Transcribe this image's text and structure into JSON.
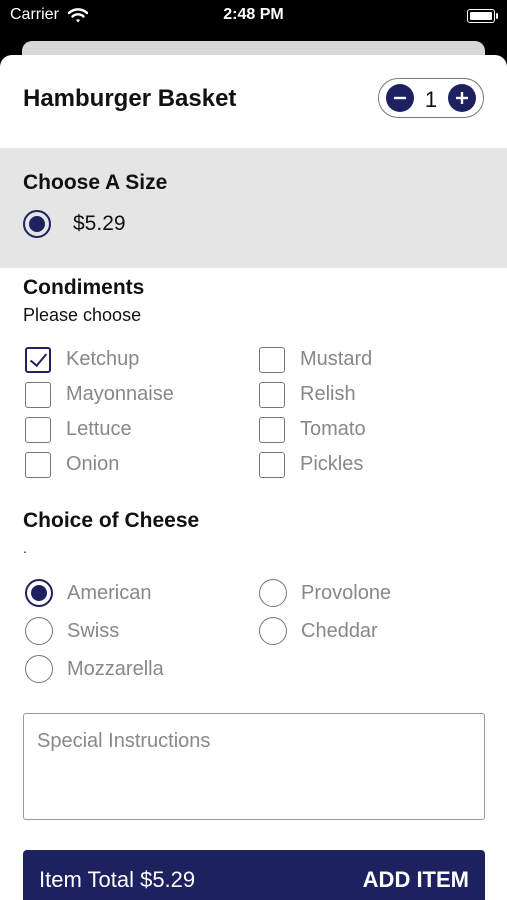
{
  "status_bar": {
    "carrier": "Carrier",
    "time": "2:48 PM"
  },
  "item": {
    "title": "Hamburger Basket",
    "quantity": "1"
  },
  "size": {
    "title": "Choose A Size",
    "price": "$5.29"
  },
  "condiments": {
    "title": "Condiments",
    "subtitle": "Please choose",
    "options": [
      {
        "label": "Ketchup",
        "checked": true
      },
      {
        "label": "Mustard",
        "checked": false
      },
      {
        "label": "Mayonnaise",
        "checked": false
      },
      {
        "label": "Relish",
        "checked": false
      },
      {
        "label": "Lettuce",
        "checked": false
      },
      {
        "label": "Tomato",
        "checked": false
      },
      {
        "label": "Onion",
        "checked": false
      },
      {
        "label": "Pickles",
        "checked": false
      }
    ]
  },
  "cheese": {
    "title": "Choice of Cheese",
    "note": ".",
    "options": [
      {
        "label": "American",
        "selected": true
      },
      {
        "label": "Provolone",
        "selected": false
      },
      {
        "label": "Swiss",
        "selected": false
      },
      {
        "label": "Cheddar",
        "selected": false
      },
      {
        "label": "Mozzarella",
        "selected": false
      }
    ]
  },
  "instructions": {
    "placeholder": "Special Instructions"
  },
  "footer": {
    "total": "Item Total $5.29",
    "add_label": "ADD ITEM"
  },
  "colors": {
    "accent": "#1e2160",
    "section_bg": "#e5e5e5",
    "muted_text": "#888888"
  },
  "icons": {
    "wifi": "wifi-icon",
    "battery": "battery-icon",
    "minus": "minus-icon",
    "plus": "plus-icon"
  }
}
